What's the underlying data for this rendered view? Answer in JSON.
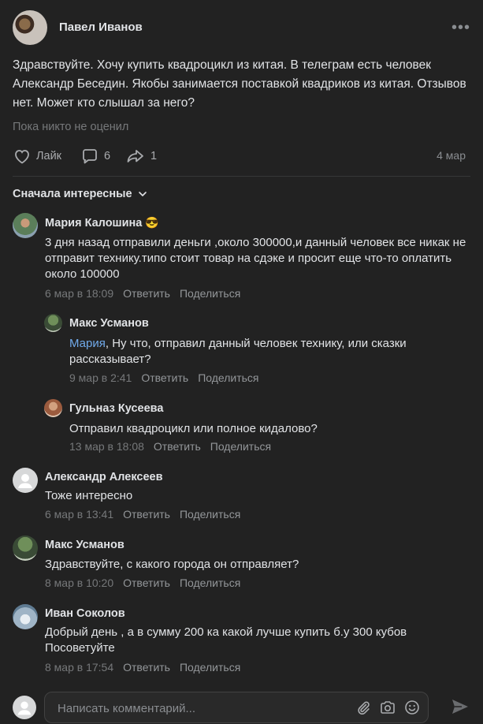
{
  "post": {
    "author": "Павел Иванов",
    "text": "Здравствуйте. Хочу купить квадроцикл из китая. В телеграм есть человек Александр Беседин. Якобы занимается поставкой квадриков из китая. Отзывов нет. Может кто слышал за него?",
    "reactions": "Пока никто не оценил",
    "like_label": "Лайк",
    "comments_count": "6",
    "shares_count": "1",
    "date": "4 мар",
    "more": "•••"
  },
  "sort": {
    "label": "Сначала интересные"
  },
  "comment_actions": {
    "reply": "Ответить",
    "share": "Поделиться"
  },
  "comments": [
    {
      "author": "Мария Калошина",
      "emoji": "😎",
      "text": "3 дня назад отправили деньги ,около 300000,и данный человек все никак не отправит технику.типо стоит товар на сдэке и просит еще что-то оплатить около 100000",
      "date": "6 мар в 18:09"
    },
    {
      "author": "Макс Усманов",
      "mention": "Мария",
      "text": ", Ну что, отправил данный человек технику, или сказки рассказывает?",
      "date": "9 мар в 2:41"
    },
    {
      "author": "Гульназ Кусеева",
      "text": "Отправил квадроцикл или полное кидалово?",
      "date": "13 мар в 18:08"
    },
    {
      "author": "Александр Алексеев",
      "text": "Тоже интересно",
      "date": "6 мар в 13:41"
    },
    {
      "author": "Макс Усманов",
      "text": "Здравствуйте, с какого города он отправляет?",
      "date": "8 мар в 10:20"
    },
    {
      "author": "Иван Соколов",
      "text": "Добрый день , а в сумму 200 ка какой лучше купить б.у 300 кубов Посоветуйте",
      "date": "8 мар в 17:54"
    }
  ],
  "composer": {
    "placeholder": "Написать комментарий..."
  },
  "colors": {
    "background": "#222222",
    "text": "#e1e3e6",
    "secondary": "#76787a",
    "link": "#71aaeb"
  }
}
